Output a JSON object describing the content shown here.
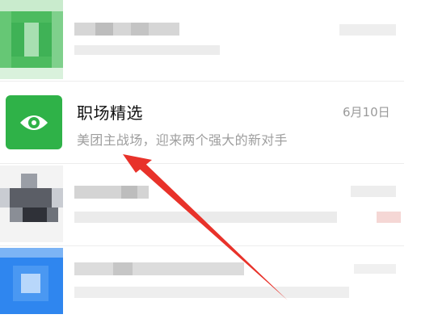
{
  "chats": [
    {
      "name": "职场精选",
      "date": "6月10日",
      "preview": "美团主战场，迎来两个强大的新对手",
      "avatar_icon": "eye-icon",
      "avatar_color": "#2fb248"
    }
  ],
  "blurred_rows": 3,
  "annotation": {
    "type": "arrow",
    "color": "#e8322a"
  }
}
